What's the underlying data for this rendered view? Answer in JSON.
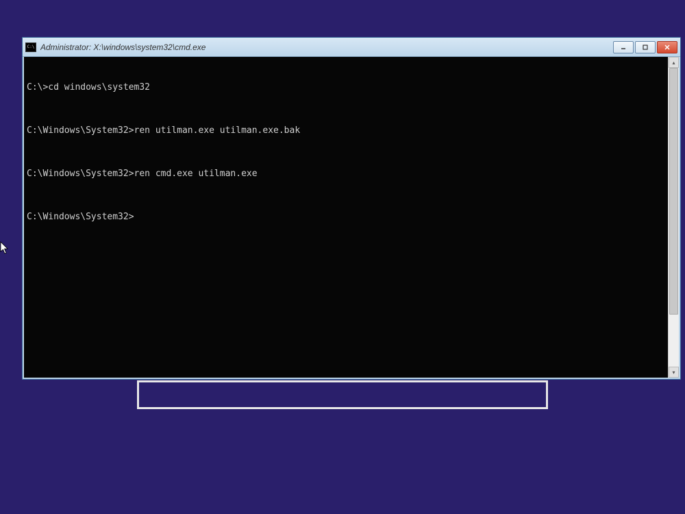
{
  "window": {
    "title": "Administrator: X:\\windows\\system32\\cmd.exe"
  },
  "terminal": {
    "lines": [
      "C:\\>cd windows\\system32",
      "C:\\Windows\\System32>ren utilman.exe utilman.exe.bak",
      "C:\\Windows\\System32>ren cmd.exe utilman.exe",
      "C:\\Windows\\System32>"
    ]
  }
}
